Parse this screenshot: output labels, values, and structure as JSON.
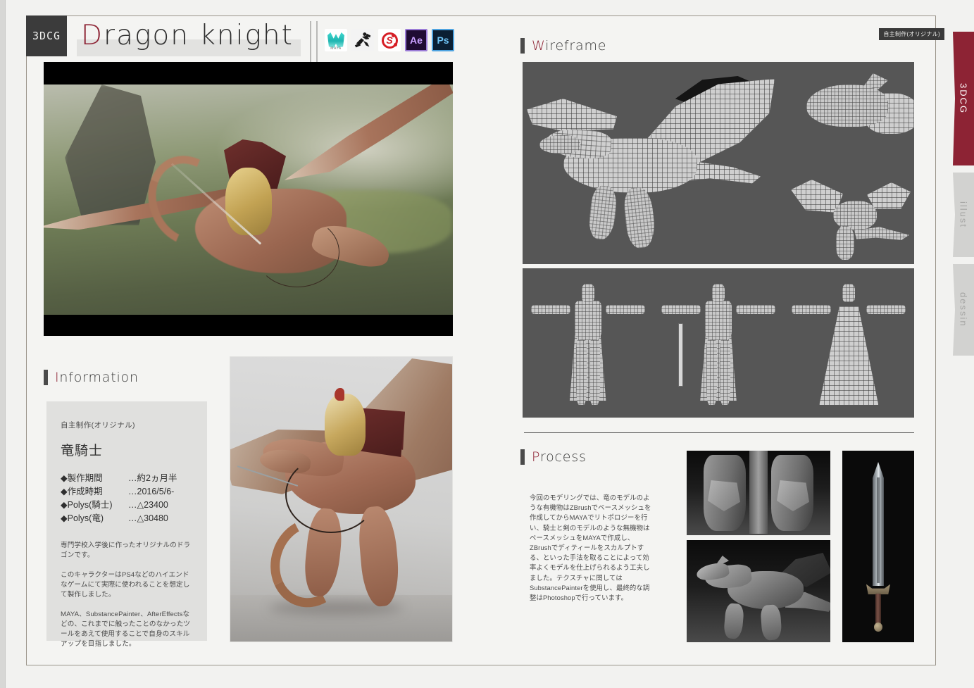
{
  "header": {
    "category_badge": "3DCG",
    "title_initial": "D",
    "title_rest": "ragon  knight",
    "origin_badge": "自主制作(オリジナル)",
    "software": [
      {
        "name": "Maya",
        "icon": "maya-icon",
        "label": "MAYA"
      },
      {
        "name": "ZBrush",
        "icon": "zbrush-icon",
        "label": ""
      },
      {
        "name": "Substance Painter",
        "icon": "substance-painter-icon",
        "label": "S"
      },
      {
        "name": "After Effects",
        "icon": "after-effects-icon",
        "label": "Ae"
      },
      {
        "name": "Photoshop",
        "icon": "photoshop-icon",
        "label": "Ps"
      }
    ]
  },
  "sections": {
    "information": {
      "initial": "I",
      "rest": "nformation"
    },
    "wireframe": {
      "initial": "W",
      "rest": "ireframe"
    },
    "process": {
      "initial": "P",
      "rest": "rocess"
    }
  },
  "information": {
    "subtitle": "自主制作(オリジナル)",
    "work_name": "竜騎士",
    "specs": [
      {
        "label": "◆製作期間",
        "value": "…約2ヵ月半"
      },
      {
        "label": "◆作成時期",
        "value": "…2016/5/6-"
      },
      {
        "label": "◆Polys(騎士)",
        "value": "…△23400"
      },
      {
        "label": "◆Polys(竜)",
        "value": "…△30480"
      }
    ],
    "paragraphs": [
      "専門学校入学後に作ったオリジナルのドラゴンです。",
      "このキャラクターはPS4などのハイエンドなゲームにて実際に使われることを想定して製作しました。",
      "MAYA、SubstancePainter、AfterEffectsなどの、これまでに触ったことのなかったツールをあえて使用することで自身のスキルアップを目指しました。"
    ]
  },
  "process": {
    "paragraphs": [
      "今回のモデリングでは、竜のモデルのような有機物はZBrushでベースメッシュを作成してからMAYAでリトポロジーを行い、騎士と剣のモデルのような無機物はベースメッシュをMAYAで作成し、ZBrushでディティールをスカルプトする、といった手法を取ることによって効率よくモデルを仕上げられるよう工夫しました。",
      "テクスチャに関してはSubstancePainterを使用し、最終的な調整はPhotoshopで行っています。"
    ],
    "images": [
      {
        "name": "armor-sculpt-zbrush"
      },
      {
        "name": "dragon-sculpt-zbrush"
      },
      {
        "name": "sword-render"
      }
    ]
  },
  "wireframe": {
    "panels": [
      {
        "name": "dragon-wireframe-full"
      },
      {
        "name": "dragon-head-wireframe-closeup"
      },
      {
        "name": "dragon-wireframe-perspective"
      },
      {
        "name": "knight-wireframe-front"
      },
      {
        "name": "knight-wireframe-side"
      },
      {
        "name": "knight-wireframe-back"
      }
    ]
  },
  "images": {
    "hero": {
      "name": "dragon-knight-flight-render"
    },
    "secondary": {
      "name": "dragon-knight-studio-render"
    }
  },
  "tabs": [
    {
      "label": "3DCG",
      "active": true
    },
    {
      "label": "illust",
      "active": false
    },
    {
      "label": "dessin",
      "active": false
    }
  ],
  "colors": {
    "accent": "#8d2334",
    "page_bg": "#f2f2f0",
    "panel_bg": "#565656",
    "info_card": "#e0e0de",
    "dark_badge": "#3b3b3b"
  }
}
